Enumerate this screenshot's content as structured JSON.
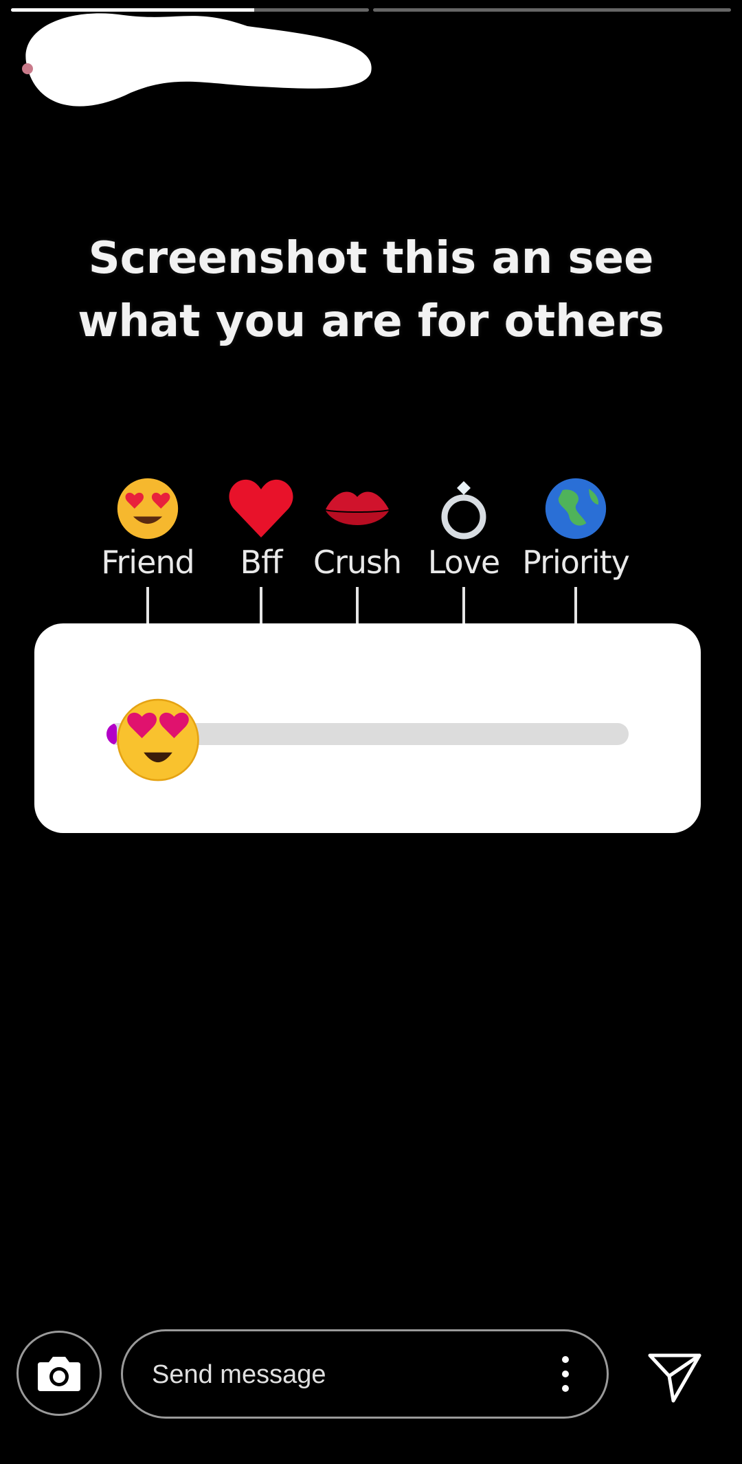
{
  "story": {
    "progress": [
      0.68,
      0
    ],
    "headline": [
      "Screenshot this an see",
      "what you are for others"
    ]
  },
  "scale": [
    {
      "label": "Friend",
      "icon": "heart-eyes-face-icon"
    },
    {
      "label": "Bff",
      "icon": "red-heart-icon"
    },
    {
      "label": "Crush",
      "icon": "kiss-lips-icon"
    },
    {
      "label": "Love",
      "icon": "ring-icon"
    },
    {
      "label": "Priority",
      "icon": "globe-icon"
    }
  ],
  "slider": {
    "emoji": "heart-eyes-emoji",
    "value": 0.02,
    "fill_color": "#b300c7",
    "track_color": "#dcdcdc"
  },
  "composer": {
    "placeholder": "Send message",
    "camera_icon": "camera-icon",
    "more_icon": "more-vertical-icon",
    "send_icon": "send-icon"
  }
}
